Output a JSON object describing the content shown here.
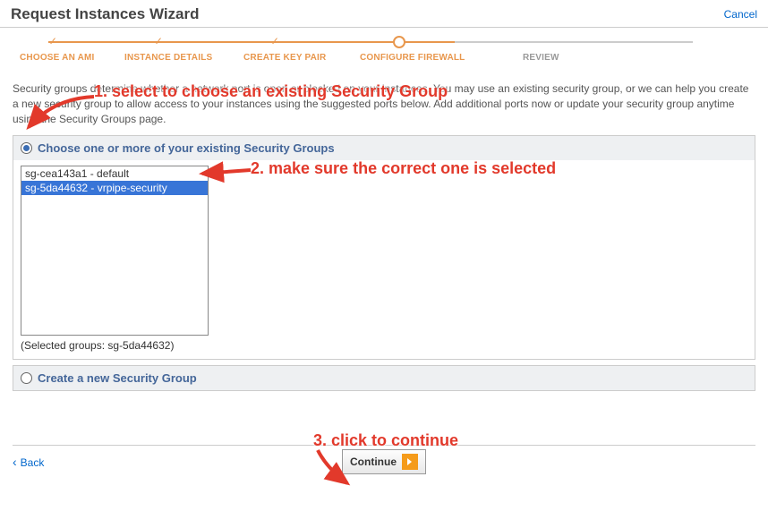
{
  "header": {
    "title": "Request Instances Wizard",
    "cancel": "Cancel"
  },
  "steps": {
    "ami": "CHOOSE AN AMI",
    "details": "INSTANCE DETAILS",
    "keypair": "CREATE KEY PAIR",
    "firewall": "CONFIGURE FIREWALL",
    "review": "REVIEW"
  },
  "description": "Security groups determine whether a network port is open or blocked on your instances. You may use an existing security group, or we can help you create a new security group to allow access to your instances using the suggested ports below. Add additional ports now or update your security group anytime using the Security Groups page.",
  "panels": {
    "existing": {
      "title": "Choose one or more of your existing Security Groups",
      "items": [
        {
          "id": "sg-cea143a1",
          "name": "default",
          "label": "sg-cea143a1 - default",
          "selected": false
        },
        {
          "id": "sg-5da44632",
          "name": "vrpipe-security",
          "label": "sg-5da44632 - vrpipe-security",
          "selected": true
        }
      ],
      "selected_text": "(Selected groups: sg-5da44632)"
    },
    "create": {
      "title": "Create a new Security Group"
    }
  },
  "footer": {
    "back": "Back",
    "continue": "Continue"
  },
  "annotations": {
    "a1": "1. select to choose an existing Security Group",
    "a2": "2. make sure the correct one is selected",
    "a3": "3. click to continue"
  }
}
